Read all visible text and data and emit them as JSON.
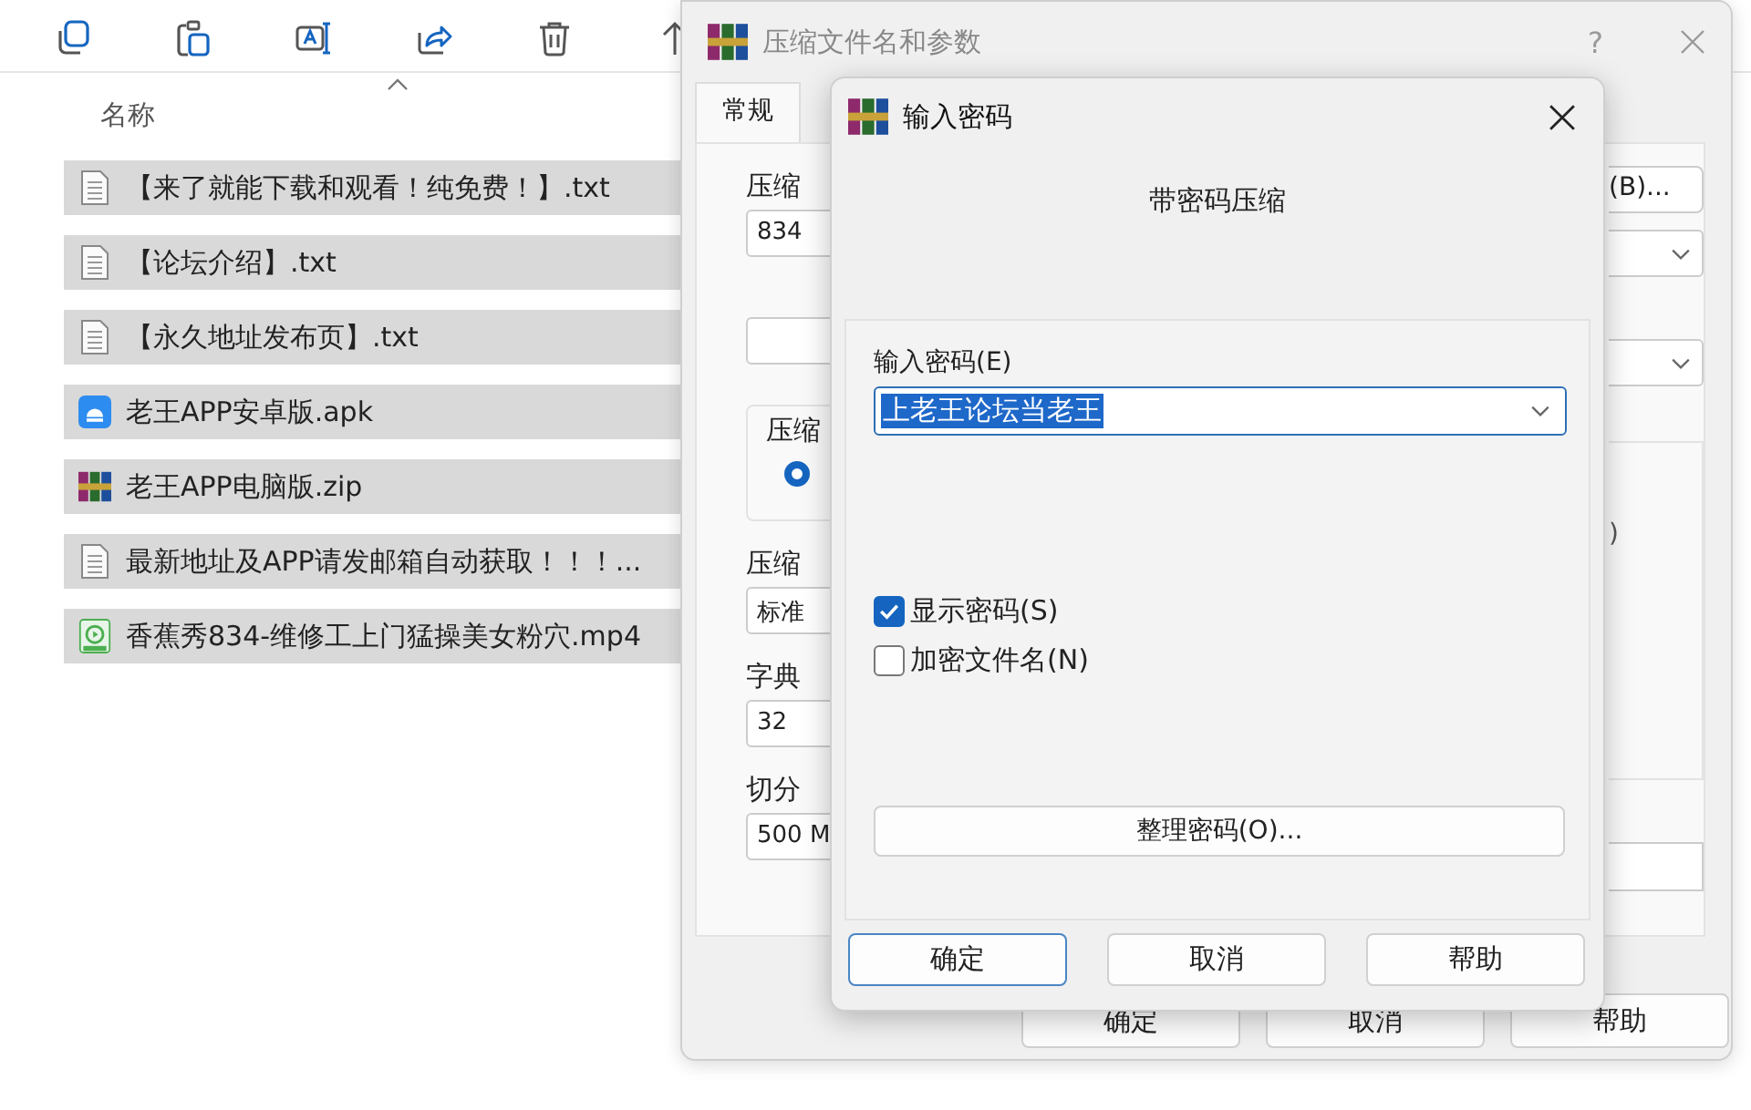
{
  "file_list": {
    "column_header": "名称",
    "rows": [
      {
        "name": "【来了就能下载和观看！纯免费！】.txt",
        "kind": "txt",
        "selected": true
      },
      {
        "name": "【论坛介绍】.txt",
        "kind": "txt",
        "selected": true
      },
      {
        "name": "【永久地址发布页】.txt",
        "kind": "txt",
        "selected": true
      },
      {
        "name": "老王APP安卓版.apk",
        "kind": "apk",
        "selected": true
      },
      {
        "name": "老王APP电脑版.zip",
        "kind": "zip",
        "selected": true
      },
      {
        "name": "最新地址及APP请发邮箱自动获取！！！...",
        "kind": "txt",
        "selected": true
      },
      {
        "name": "香蕉秀834-维修工上门猛操美女粉穴.mp4",
        "kind": "mp4",
        "selected": true
      }
    ]
  },
  "archive_dialog": {
    "title": "压缩文件名和参数",
    "help": "?",
    "tabs": [
      {
        "label": "常规",
        "selected": true
      }
    ],
    "left": [
      {
        "kind": "label",
        "text": "压缩"
      },
      {
        "kind": "field",
        "text": "834"
      },
      {
        "kind": "field"
      },
      {
        "kind": "group",
        "text": "压缩",
        "radio_selected": true
      },
      {
        "kind": "label",
        "text": "压缩"
      },
      {
        "kind": "field",
        "text": "标准"
      },
      {
        "kind": "label",
        "text": "字典"
      },
      {
        "kind": "field",
        "text": "32"
      },
      {
        "kind": "label",
        "text": "切分"
      },
      {
        "kind": "field",
        "text": "500 M"
      }
    ],
    "right": [
      {
        "kind": "button",
        "text": "(B)..."
      },
      {
        "kind": "dropdown"
      },
      {
        "kind": "dropdown"
      },
      {
        "kind": "group",
        "text": ")"
      },
      {
        "kind": "field"
      }
    ],
    "buttons": [
      "确定",
      "取消",
      "帮助"
    ]
  },
  "password_dialog": {
    "title": "输入密码",
    "heading": "带密码压缩",
    "password_label": "输入密码(E)",
    "password_value": "上老王论坛当老王",
    "options": [
      {
        "label": "显示密码(S)",
        "checked": true
      },
      {
        "label": "加密文件名(N)",
        "checked": false
      }
    ],
    "organize_button": "整理密码(O)...",
    "buttons": [
      {
        "label": "确定",
        "focused": true
      },
      {
        "label": "取消",
        "focused": false
      },
      {
        "label": "帮助",
        "focused": false
      }
    ]
  }
}
